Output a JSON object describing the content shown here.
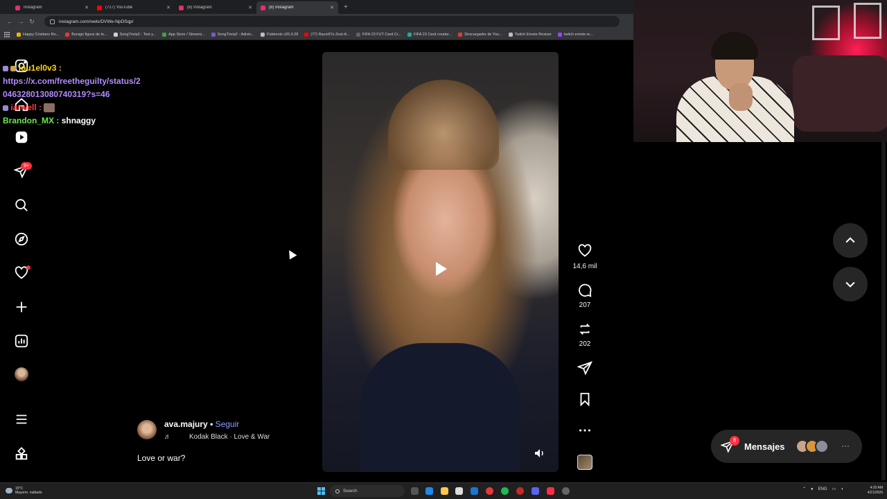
{
  "browser": {
    "tabs": [
      {
        "title": "Instagram",
        "color": "#e1306c"
      },
      {
        "title": "(717) YouTube",
        "color": "#ff0000"
      },
      {
        "title": "(8) Instagram",
        "color": "#e1306c"
      },
      {
        "title": "(8) Instagram",
        "color": "#e1306c",
        "active": true
      }
    ],
    "new_tab_icon": "plus-icon",
    "url": "instagram.com/reels/DVWe-NpDSqp/",
    "bookmarks": [
      {
        "label": "Happy Cristiano Ro...",
        "color": "#f4b400"
      },
      {
        "label": "Burago figura de to...",
        "color": "#e53935"
      },
      {
        "label": "SongTrivia2 - Test y...",
        "color": "#d0d0d0"
      },
      {
        "label": "App Store / Streami...",
        "color": "#43a047"
      },
      {
        "label": "SongTrivia2 - Adivin...",
        "color": "#7e57c2"
      },
      {
        "label": "Paletools v26.0.28",
        "color": "#bdbdbd"
      },
      {
        "label": "(77) Racoi97s Zest-A...",
        "color": "#ff0000"
      },
      {
        "label": "FIFA 23 FUT Card Cr...",
        "color": "#616161"
      },
      {
        "label": "FIFA 23 Card creator...",
        "color": "#26a69a"
      },
      {
        "label": "Descargador de You...",
        "color": "#e53935"
      },
      {
        "label": "Twitch Emote Resizer",
        "color": "#bdbdbd"
      },
      {
        "label": "twitch emote re...",
        "color": "#9146ff"
      }
    ]
  },
  "chat": {
    "line1_user": "lou1el0v3 :",
    "line1_link": "https://x.com/freetheguilty/status/2046328013080740319?s=46",
    "line1_link_a": "https://x.com/freetheguilty/status/2",
    "line1_link_b": "046328013080740319?s=46",
    "line2_user": "iarwell :",
    "line3_user": "Brandon_MX :",
    "line3_msg": "shnaggy"
  },
  "sidebar": {
    "messages_badge": "9+"
  },
  "reel": {
    "likes": "14,6 mil",
    "comments": "207",
    "reposts": "202",
    "username": "ava.majury",
    "separator": "•",
    "follow_label": "Seguir",
    "song": "Kodak Black · Love & War",
    "caption": "Love or war?"
  },
  "messages": {
    "label": "Mensajes",
    "badge": "8",
    "more": "···"
  },
  "taskbar": {
    "weather_temp": "15°C",
    "weather_desc": "Mayorm. nublado",
    "search_placeholder": "Search",
    "lang": "ENG",
    "time": "4:20 AM",
    "date": "4/21/2026"
  },
  "colors": {
    "accent_follow": "#8f9cff",
    "notification": "#ff3040",
    "chat_link": "#b38cff",
    "chat_user_yellow": "#ffd700",
    "chat_user_green": "#6be84a"
  }
}
